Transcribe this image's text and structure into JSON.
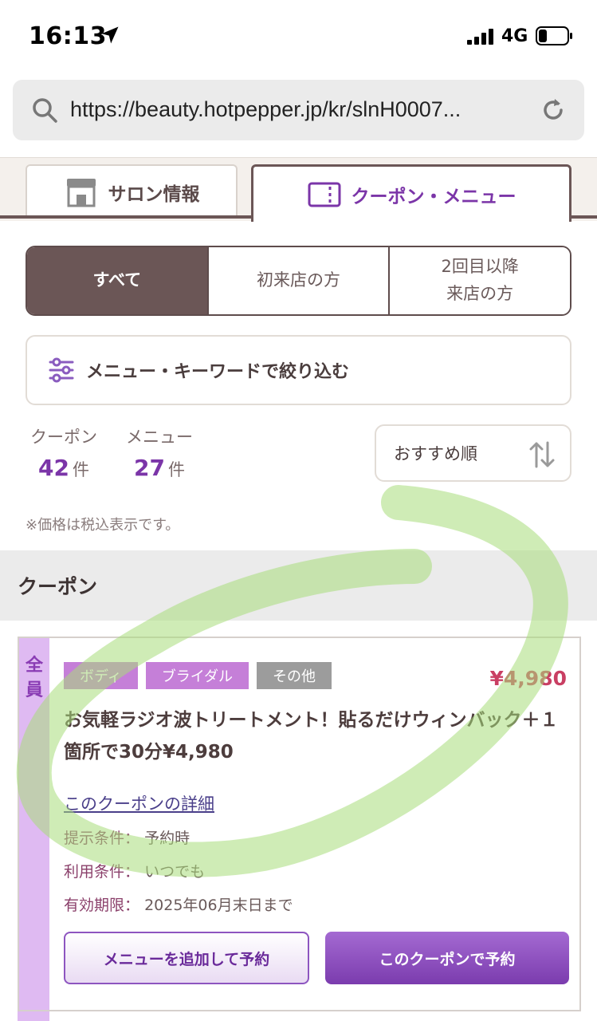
{
  "status_bar": {
    "time": "16:13",
    "network": "4G",
    "icons": [
      "location-arrow-icon",
      "signal-icon",
      "battery-icon"
    ]
  },
  "browser": {
    "url": "https://beauty.hotpepper.jp/kr/slnH0007...",
    "icons": [
      "search-icon",
      "reload-icon"
    ]
  },
  "tabs": [
    {
      "label": "サロン情報",
      "icon": "store-icon",
      "active": false
    },
    {
      "label": "クーポン・メニュー",
      "icon": "coupon-icon",
      "active": true
    }
  ],
  "segments": {
    "all": "すべて",
    "first_visit": "初来店の方",
    "repeat_line1": "2回目以降",
    "repeat_line2": "来店の方"
  },
  "filter": {
    "label": "メニュー・キーワードで絞り込む",
    "icon": "sliders-icon"
  },
  "counts": {
    "coupon_label": "クーポン",
    "coupon_value": "42",
    "coupon_unit": "件",
    "menu_label": "メニュー",
    "menu_value": "27",
    "menu_unit": "件"
  },
  "sort": {
    "label": "おすすめ順",
    "icon": "sort-arrows-icon"
  },
  "tax_note": "※価格は税込表示です。",
  "section_title": "クーポン",
  "coupon": {
    "target": [
      "全",
      "員"
    ],
    "tags": [
      "ボディ",
      "ブライダル",
      "その他"
    ],
    "price": "¥4,980",
    "title": "お気軽ラジオ波トリートメント！貼るだけウィンバック＋１箇所で30分¥4,980",
    "detail_link": "このクーポンの詳細",
    "conditions": [
      {
        "key": "提示条件：",
        "value": "予約時"
      },
      {
        "key": "利用条件：",
        "value": "いつでも"
      },
      {
        "key": "有効期限：",
        "value": "2025年06月末日まで"
      }
    ],
    "add_menu_button": "メニューを追加して予約",
    "reserve_button": "このクーポンで予約"
  },
  "colors": {
    "brand_purple": "#7b35a8",
    "brown": "#6b5656",
    "price_red": "#c93f63",
    "highlight_green": "#a8dc7a"
  }
}
